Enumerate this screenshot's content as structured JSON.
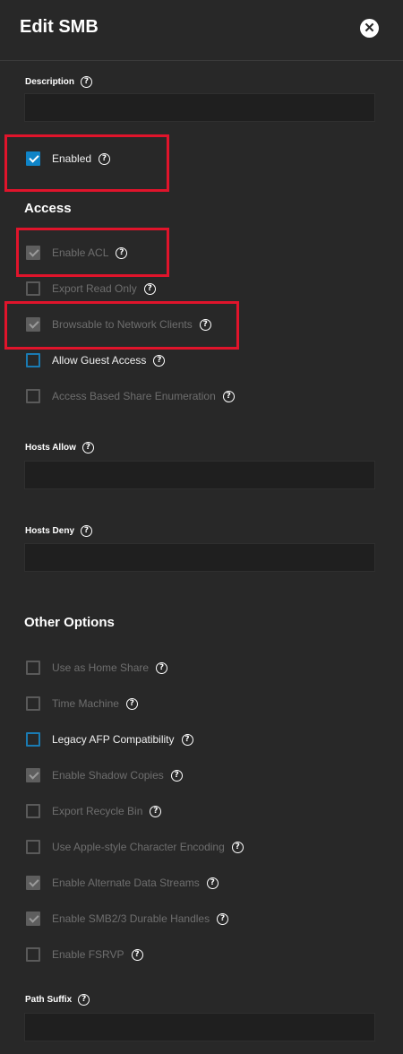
{
  "header": {
    "title": "Edit SMB",
    "close_icon": "close-icon"
  },
  "fields": {
    "description": {
      "label": "Description",
      "value": ""
    },
    "hosts_allow": {
      "label": "Hosts Allow",
      "value": ""
    },
    "hosts_deny": {
      "label": "Hosts Deny",
      "value": ""
    },
    "path_suffix": {
      "label": "Path Suffix",
      "value": ""
    }
  },
  "enabled": {
    "label": "Enabled",
    "checked": true
  },
  "sections": {
    "access": "Access",
    "other_options": "Other Options"
  },
  "access_options": [
    {
      "label": "Enable ACL",
      "checked": true,
      "disabled": true
    },
    {
      "label": "Export Read Only",
      "checked": false,
      "disabled": true
    },
    {
      "label": "Browsable to Network Clients",
      "checked": true,
      "disabled": true
    },
    {
      "label": "Allow Guest Access",
      "checked": false,
      "disabled": false
    },
    {
      "label": "Access Based Share Enumeration",
      "checked": false,
      "disabled": true
    }
  ],
  "other_options": [
    {
      "label": "Use as Home Share",
      "checked": false,
      "disabled": true
    },
    {
      "label": "Time Machine",
      "checked": false,
      "disabled": true
    },
    {
      "label": "Legacy AFP Compatibility",
      "checked": false,
      "disabled": false
    },
    {
      "label": "Enable Shadow Copies",
      "checked": true,
      "disabled": true
    },
    {
      "label": "Export Recycle Bin",
      "checked": false,
      "disabled": true
    },
    {
      "label": "Use Apple-style Character Encoding",
      "checked": false,
      "disabled": true
    },
    {
      "label": "Enable Alternate Data Streams",
      "checked": true,
      "disabled": true
    },
    {
      "label": "Enable SMB2/3 Durable Handles",
      "checked": true,
      "disabled": true
    },
    {
      "label": "Enable FSRVP",
      "checked": false,
      "disabled": true
    }
  ],
  "colors": {
    "background": "#282828",
    "input_bg": "#1f1f1f",
    "accent": "#0f84c7",
    "highlight": "#e0142b"
  }
}
